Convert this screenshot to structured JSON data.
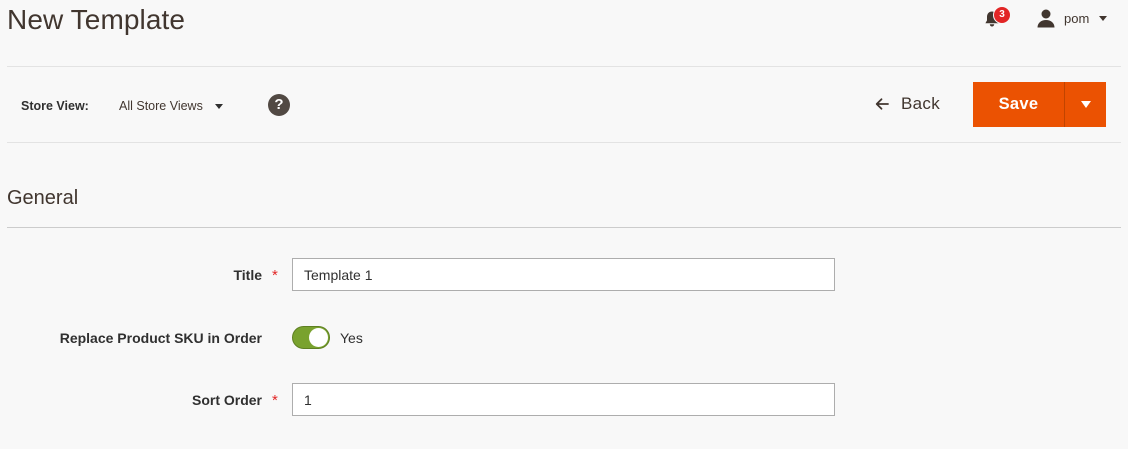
{
  "header": {
    "title": "New Template",
    "notifications": {
      "icon": "bell-icon",
      "count": "3"
    },
    "user": {
      "icon": "user-icon",
      "name": "pom"
    }
  },
  "toolbar": {
    "store_view_label": "Store View:",
    "store_view_value": "All Store Views",
    "help_icon": "?",
    "back_label": "Back",
    "save_label": "Save"
  },
  "section": {
    "title": "General"
  },
  "form": {
    "title_label": "Title",
    "title_value": "Template 1",
    "replace_sku_label": "Replace Product SKU in Order",
    "replace_sku_state": "Yes",
    "sort_order_label": "Sort Order",
    "sort_order_value": "1",
    "required_marker": "*"
  },
  "colors": {
    "accent": "#eb5202",
    "toggle_on": "#79a22e",
    "required": "#e22626"
  }
}
